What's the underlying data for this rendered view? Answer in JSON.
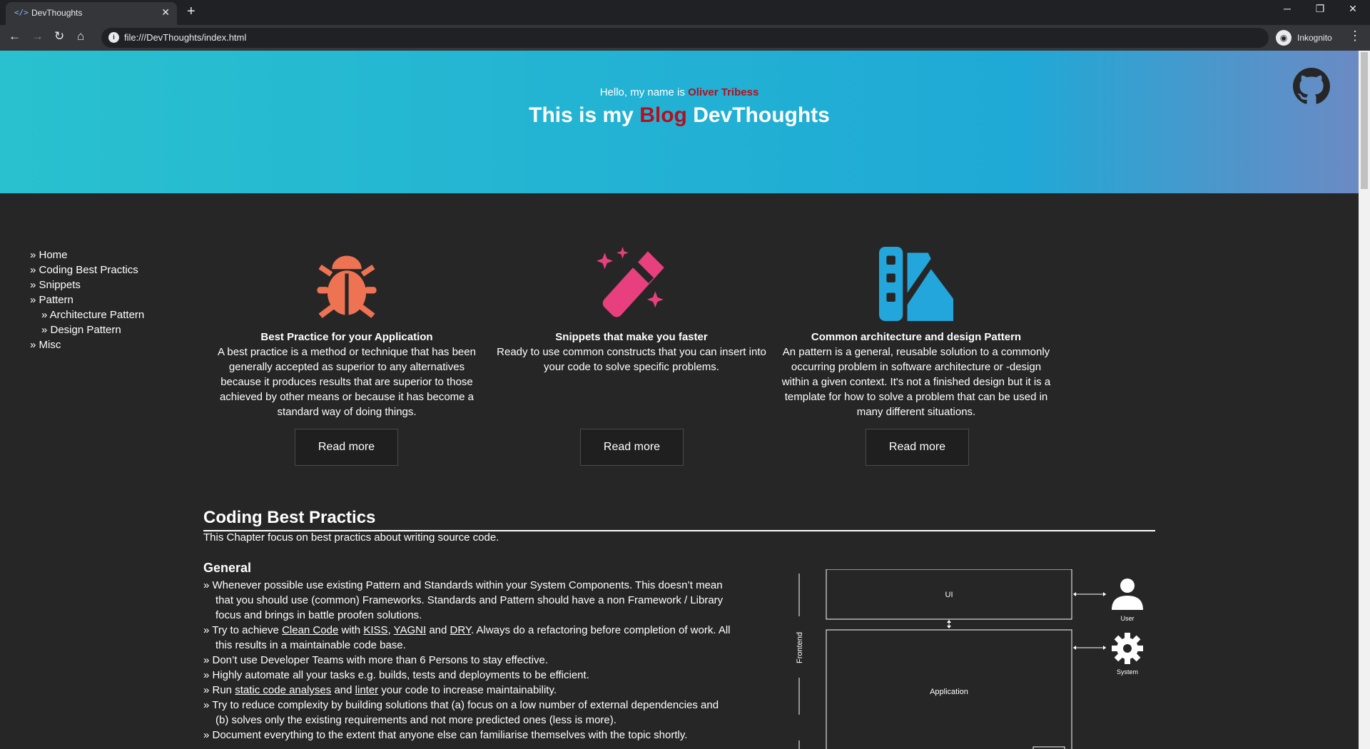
{
  "browser": {
    "tab_title": "DevThoughts",
    "tab_icon": "</>",
    "url": "file:///DevThoughts/index.html",
    "incognito_label": "Inkognito"
  },
  "hero": {
    "greeting": "Hello, my name is",
    "name": "Oliver Tribess",
    "title_prefix": "This is my",
    "title_accent": "Blog",
    "title_suffix": "DevThoughts"
  },
  "sidenav": {
    "home": "» Home",
    "coding": "» Coding Best Practics",
    "snippets": "» Snippets",
    "pattern": "» Pattern",
    "architecture": "» Architecture Pattern",
    "design": "» Design Pattern",
    "misc": "» Misc"
  },
  "cards": [
    {
      "title": "Best Practice for your Application",
      "text": "A best practice is a method or technique that has been generally accepted as superior to any alternatives because it produces results that are superior to those achieved by other means or because it has become a standard way of doing things.",
      "button": "Read more",
      "icon": "bug-icon",
      "color": "#ee7353"
    },
    {
      "title": "Snippets that make you faster",
      "text": "Ready to use common constructs that you can insert into your code to solve specific problems.",
      "button": "Read more",
      "icon": "magic-wand-icon",
      "color": "#e8407e"
    },
    {
      "title": "Common architecture and design Pattern",
      "text": "An pattern is a general, reusable solution to a commonly occurring problem in software architecture or -design within a given context. It's not a finished design but it is a template for how to solve a problem that can be used in many different situations.",
      "button": "Read more",
      "icon": "swatchbook-icon",
      "color": "#22a6db"
    }
  ],
  "section": {
    "title": "Coding Best Practics",
    "intro": "This Chapter focus on best practics about writing source code.",
    "subtitle": "General",
    "b1": "» Whenever possible use existing Pattern and Standards within your System Components. This doesn’t mean that you should use (common) Frameworks. Standards and Pattern should have a non Framework / Library focus and brings in battle proofen solutions.",
    "b2_a": "» Try to achieve",
    "b2_link1": "Clean Code",
    "b2_b": "with",
    "b2_link2": "KISS",
    "b2_sep": ",",
    "b2_link3": "YAGNI",
    "b2_c": "and",
    "b2_link4": "DRY",
    "b2_d": ". Always do a refactoring before completion of work. All this results in a maintainable code base.",
    "b3": "» Don’t use Developer Teams with more than 6 Persons to stay effective.",
    "b4": "» Highly automate all your tasks e.g. builds, tests and deployments to be efficient.",
    "b5_a": "» Run",
    "b5_link1": "static code analyses",
    "b5_b": "and",
    "b5_link2": "linter",
    "b5_c": "your code to increase maintainability.",
    "b6": "» Try to reduce complexity by building solutions that (a) focus on a low number of external dependencies and (b) solves only the existing requirements and not more predicted ones (less is more).",
    "b7": "» Document everything to the extent that anyone else can familiarise themselves with the topic shortly."
  },
  "diagram": {
    "ui": "UI",
    "application": "Application",
    "frontend": "Frontend",
    "user": "User",
    "system": "System"
  }
}
